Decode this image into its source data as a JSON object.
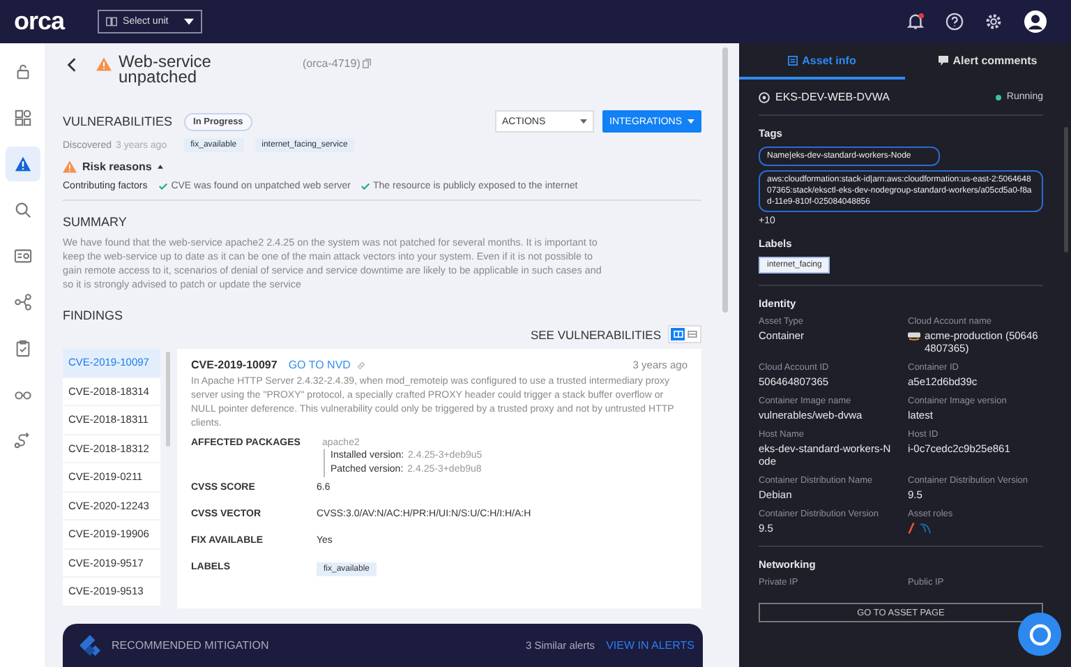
{
  "header": {
    "logo": "orca",
    "unit_select": "Select unit",
    "notification_badge": true
  },
  "sidebar": {
    "items": [
      {
        "kind": "lock",
        "selected": false
      },
      {
        "kind": "dashboard",
        "selected": false
      },
      {
        "kind": "alert",
        "selected": true
      },
      {
        "kind": "search",
        "selected": false
      },
      {
        "kind": "inventory",
        "selected": false
      },
      {
        "kind": "graph",
        "selected": false
      },
      {
        "kind": "compliance",
        "selected": false
      },
      {
        "kind": "glasses",
        "selected": false
      },
      {
        "kind": "route",
        "selected": false
      }
    ]
  },
  "alert": {
    "title": "Web-service unpatched",
    "id": "(orca-4719)",
    "category": "VULNERABILITIES",
    "status": "In Progress",
    "actions": "ACTIONS",
    "integrations": "INTEGRATIONS",
    "discovered_label": "Discovered",
    "discovered_time": "3 years ago",
    "labels": [
      "fix_available",
      "internet_facing_service"
    ],
    "risk_title": "Risk reasons",
    "contributing_label": "Contributing factors",
    "factors": [
      "CVE was found on unpatched web server",
      "The resource is publicly exposed to the internet"
    ]
  },
  "summary": {
    "heading": "SUMMARY",
    "text": "We have found that the web-service apache2 2.4.25 on the system was not patched for several months. It is important to keep the web-service up to date as it can be one of the main attack vectors into your system. Even if it is not possible to gain remote access to it, scenarios of denial of service and service downtime are likely to be applicable in such cases and so it is strongly advised to patch or update the service"
  },
  "findings": {
    "heading": "FINDINGS",
    "see_label": "SEE VULNERABILITIES",
    "views": [
      {
        "kind": "split",
        "selected": true
      },
      {
        "kind": "list",
        "selected": false
      }
    ],
    "list": [
      {
        "cve": "CVE-2019-10097",
        "selected": true
      },
      {
        "cve": "CVE-2018-18314",
        "selected": false
      },
      {
        "cve": "CVE-2018-18311",
        "selected": false
      },
      {
        "cve": "CVE-2018-18312",
        "selected": false
      },
      {
        "cve": "CVE-2019-0211",
        "selected": false
      },
      {
        "cve": "CVE-2020-12243",
        "selected": false
      },
      {
        "cve": "CVE-2019-19906",
        "selected": false
      },
      {
        "cve": "CVE-2019-9517",
        "selected": false
      },
      {
        "cve": "CVE-2019-9513",
        "selected": false
      }
    ],
    "detail": {
      "cve": "CVE-2019-10097",
      "link": "GO TO NVD",
      "time": "3 years ago",
      "description": "In Apache HTTP Server 2.4.32-2.4.39, when mod_remoteip was configured to use a trusted intermediary proxy server using the \"PROXY\" protocol, a specially crafted PROXY header could trigger a stack buffer overflow or NULL pointer deference. This vulnerability could only be triggered by a trusted proxy and not by untrusted HTTP clients.",
      "fields": [
        {
          "kind": "package",
          "label": "AFFECTED PACKAGES",
          "name": "apache2",
          "installed_label": "Installed version:",
          "installed": "2.4.25-3+deb9u5",
          "patched_label": "Patched version:",
          "patched": "2.4.25-3+deb9u8"
        },
        {
          "kind": "text",
          "label": "CVSS SCORE",
          "value": "6.6"
        },
        {
          "kind": "text",
          "label": "CVSS VECTOR",
          "value": "CVSS:3.0/AV:N/AC:H/PR:H/UI:N/S:U/C:H/I:H/A:H"
        },
        {
          "kind": "text",
          "label": "FIX AVAILABLE",
          "value": "Yes"
        },
        {
          "kind": "labels",
          "label": "LABELS",
          "labels": [
            "fix_available"
          ]
        }
      ]
    }
  },
  "mitigation": {
    "title": "RECOMMENDED MITIGATION",
    "similar": "3 Similar alerts",
    "link": "VIEW IN ALERTS"
  },
  "panel": {
    "tabs": [
      {
        "kind": "asset",
        "label": "Asset info",
        "selected": true
      },
      {
        "kind": "comments",
        "label": "Alert comments",
        "selected": false
      }
    ],
    "asset_name": "EKS-DEV-WEB-DVWA",
    "status": "Running",
    "tags_heading": "Tags",
    "tags": [
      "Name|eks-dev-standard-workers-Node",
      "aws:cloudformation:stack-id|arn:aws:cloudformation:us-east-2:506464807365:stack/eksctl-eks-dev-nodegroup-standard-workers/a05cd5a0-f8ad-11e9-810f-025084048856"
    ],
    "more_tags": "+10",
    "labels_heading": "Labels",
    "labels": [
      "internet_facing"
    ],
    "identity_heading": "Identity",
    "fields": [
      {
        "kind": "text",
        "label": "Asset Type",
        "value": "Container"
      },
      {
        "kind": "cloud_account",
        "label": "Cloud Account name",
        "value": "acme-production (506464807365)"
      },
      {
        "kind": "text",
        "label": "Cloud Account ID",
        "value": "506464807365"
      },
      {
        "kind": "text",
        "label": "Container ID",
        "value": "a5e12d6bd39c"
      },
      {
        "kind": "text",
        "label": "Container Image name",
        "value": "vulnerables/web-dvwa"
      },
      {
        "kind": "text",
        "label": "Container Image version",
        "value": "latest"
      },
      {
        "kind": "text",
        "label": "Host Name",
        "value": "eks-dev-standard-workers-Node"
      },
      {
        "kind": "text",
        "label": "Host ID",
        "value": "i-0c7cedc2c9b25e861"
      },
      {
        "kind": "text",
        "label": "Container Distribution Name",
        "value": "Debian"
      },
      {
        "kind": "text",
        "label": "Container Distribution Version",
        "value": "9.5"
      },
      {
        "kind": "text",
        "label": "Container Distribution Version",
        "value": "9.5"
      },
      {
        "kind": "roles",
        "label": "Asset roles"
      }
    ],
    "networking_heading": "Networking",
    "network_fields": [
      "Private IP",
      "Public IP"
    ],
    "button": "GO TO ASSET PAGE"
  }
}
